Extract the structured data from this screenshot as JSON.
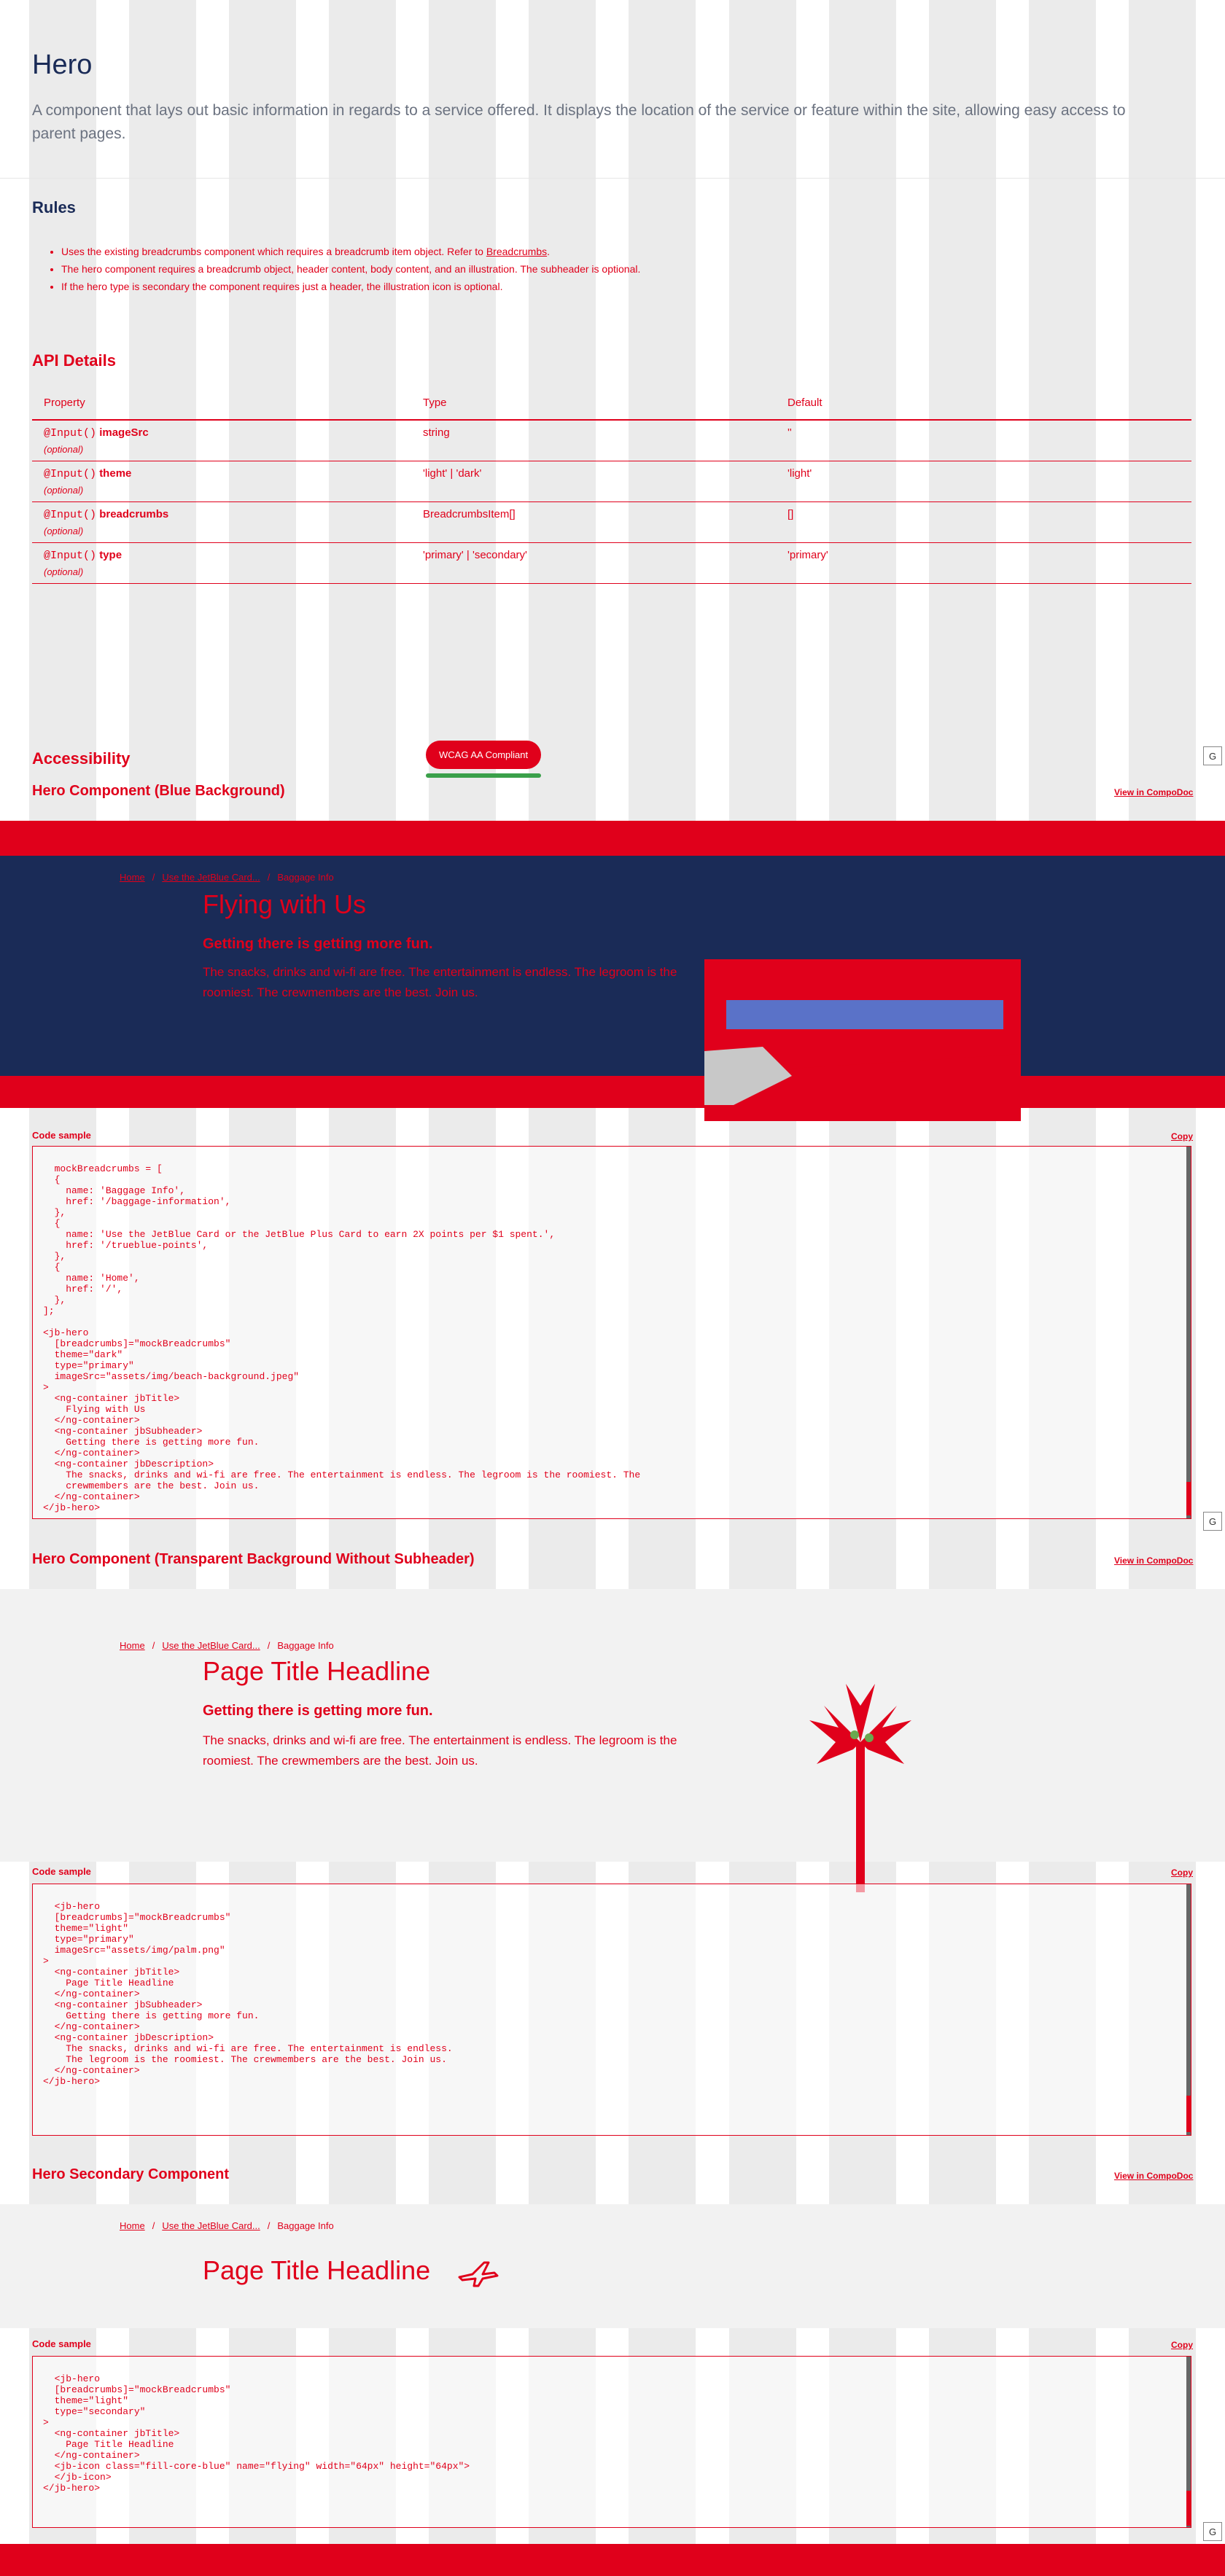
{
  "header": {
    "title": "Hero",
    "description": "A component that lays out basic information in regards to a service offered. It displays the location of the service or feature within the site, allowing easy access to parent pages."
  },
  "rules": {
    "heading": "Rules",
    "items": [
      {
        "text": "Uses the existing breadcrumbs component which requires a breadcrumb item object. Refer to ",
        "link": "Breadcrumbs",
        "suffix": "."
      },
      {
        "text": "The hero component requires a breadcrumb object, header content, body content, and an illustration. The subheader is optional."
      },
      {
        "text": "If the hero type is secondary the component requires just a header, the illustration icon is optional."
      }
    ]
  },
  "api": {
    "heading": "API Details",
    "columns": [
      "Property",
      "Type",
      "Default"
    ],
    "rows": [
      {
        "decorator": "@Input()",
        "name": "imageSrc",
        "optional": "(optional)",
        "type": "string",
        "default": "''"
      },
      {
        "decorator": "@Input()",
        "name": "theme",
        "optional": "(optional)",
        "type": "'light' | 'dark'",
        "default": "'light'"
      },
      {
        "decorator": "@Input()",
        "name": "breadcrumbs",
        "optional": "(optional)",
        "type": "BreadcrumbsItem[]",
        "default": "[]"
      },
      {
        "decorator": "@Input()",
        "name": "type",
        "optional": "(optional)",
        "type": "'primary' | 'secondary'",
        "default": "'primary'"
      }
    ]
  },
  "accessibility": {
    "heading": "Accessibility",
    "badge": "WCAG AA Compliant"
  },
  "section_blue": {
    "heading": "Hero Component (Blue Background)",
    "compodoc": "View in CompoDoc",
    "breadcrumbs": [
      "Home",
      "Use the JetBlue Card...",
      "Baggage Info"
    ],
    "title": "Flying with Us",
    "subheader": "Getting there is getting more fun.",
    "body": "The snacks, drinks and wi-fi are free. The entertainment is endless. The legroom is the roomiest. The crewmembers are the best. Join us.",
    "code_label": "Code sample",
    "copy": "Copy",
    "code": "mockBreadcrumbs = [\n  {\n    name: 'Baggage Info',\n    href: '/baggage-information',\n  },\n  {\n    name: 'Use the JetBlue Card or the JetBlue Plus Card to earn 2X points per $1 spent.',\n    href: '/trueblue-points',\n  },\n  {\n    name: 'Home',\n    href: '/',\n  },\n];\n\n<jb-hero\n  [breadcrumbs]=\"mockBreadcrumbs\"\n  theme=\"dark\"\n  type=\"primary\"\n  imageSrc=\"assets/img/beach-background.jpeg\"\n>\n  <ng-container jbTitle>\n    Flying with Us\n  </ng-container>\n  <ng-container jbSubheader>\n    Getting there is getting more fun.\n  </ng-container>\n  <ng-container jbDescription>\n    The snacks, drinks and wi-fi are free. The entertainment is endless. The legroom is the roomiest. The\n    crewmembers are the best. Join us.\n  </ng-container>\n</jb-hero>"
  },
  "section_transparent": {
    "heading": "Hero Component (Transparent Background Without Subheader)",
    "compodoc": "View in CompoDoc",
    "breadcrumbs": [
      "Home",
      "Use the JetBlue Card...",
      "Baggage Info"
    ],
    "title": "Page Title Headline",
    "subheader": "Getting there is getting more fun.",
    "body": "The snacks, drinks and wi-fi are free. The entertainment is endless. The legroom is the roomiest. The crewmembers are the best. Join us.",
    "code_label": "Code sample",
    "copy": "Copy",
    "code": "<jb-hero\n  [breadcrumbs]=\"mockBreadcrumbs\"\n  theme=\"light\"\n  type=\"primary\"\n  imageSrc=\"assets/img/palm.png\"\n>\n  <ng-container jbTitle>\n    Page Title Headline\n  </ng-container>\n  <ng-container jbSubheader>\n    Getting there is getting more fun.\n  </ng-container>\n  <ng-container jbDescription>\n    The snacks, drinks and wi-fi are free. The entertainment is endless.\n    The legroom is the roomiest. The crewmembers are the best. Join us.\n  </ng-container>\n</jb-hero>"
  },
  "section_secondary": {
    "heading": "Hero Secondary Component",
    "compodoc": "View in CompoDoc",
    "breadcrumbs": [
      "Home",
      "Use the JetBlue Card...",
      "Baggage Info"
    ],
    "title": "Page Title Headline",
    "code_label": "Code sample",
    "copy": "Copy",
    "code": "<jb-hero\n  [breadcrumbs]=\"mockBreadcrumbs\"\n  theme=\"light\"\n  type=\"secondary\"\n>\n  <ng-container jbTitle>\n    Page Title Headline\n  </ng-container>\n  <jb-icon class=\"fill-core-blue\" name=\"flying\" width=\"64px\" height=\"64px\">\n  </jb-icon>\n</jb-hero>"
  },
  "misc": {
    "g_badge": "G"
  },
  "colors": {
    "accent": "#e0001b",
    "navy": "#1a2b57",
    "grid": "#dcdcdc"
  }
}
